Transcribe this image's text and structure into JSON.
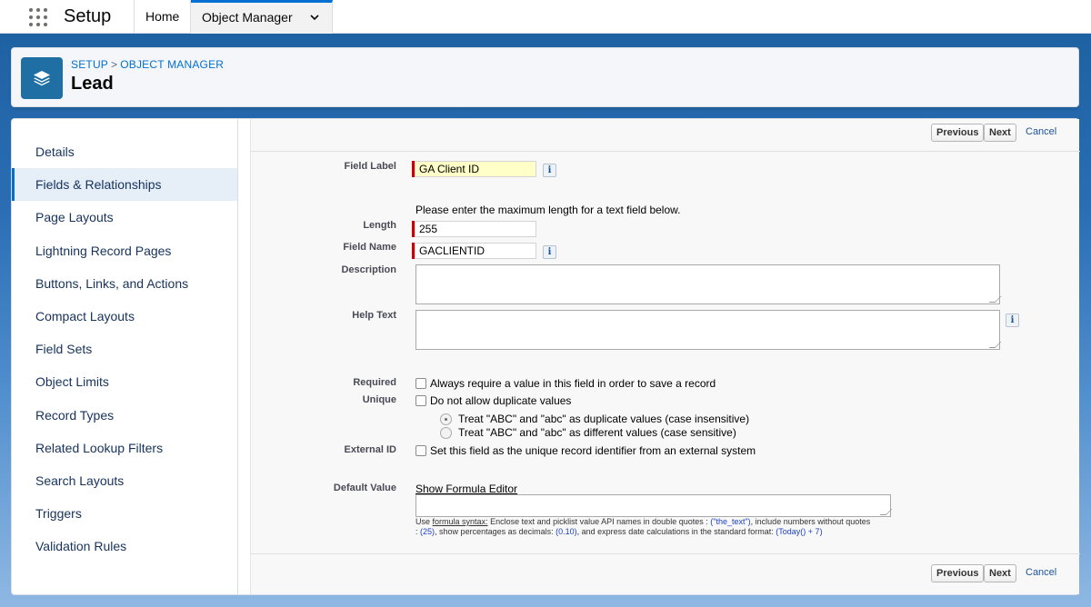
{
  "app": {
    "title": "Setup"
  },
  "nav": {
    "home": "Home",
    "object_manager": "Object Manager"
  },
  "header": {
    "breadcrumb_setup": "SETUP",
    "breadcrumb_sep": ">",
    "breadcrumb_om": "OBJECT MANAGER",
    "title": "Lead"
  },
  "sidebar": {
    "items": [
      {
        "label": "Details"
      },
      {
        "label": "Fields & Relationships"
      },
      {
        "label": "Page Layouts"
      },
      {
        "label": "Lightning Record Pages"
      },
      {
        "label": "Buttons, Links, and Actions"
      },
      {
        "label": "Compact Layouts"
      },
      {
        "label": "Field Sets"
      },
      {
        "label": "Object Limits"
      },
      {
        "label": "Record Types"
      },
      {
        "label": "Related Lookup Filters"
      },
      {
        "label": "Search Layouts"
      },
      {
        "label": "Triggers"
      },
      {
        "label": "Validation Rules"
      }
    ],
    "active_index": 1
  },
  "buttons": {
    "previous": "Previous",
    "next": "Next",
    "cancel": "Cancel"
  },
  "form": {
    "field_label": {
      "label": "Field Label",
      "value": "GA Client ID"
    },
    "length_note": "Please enter the maximum length for a text field below.",
    "length": {
      "label": "Length",
      "value": "255"
    },
    "field_name": {
      "label": "Field Name",
      "value": "GACLIENTID"
    },
    "description": {
      "label": "Description",
      "value": ""
    },
    "help_text": {
      "label": "Help Text",
      "value": ""
    },
    "required": {
      "label": "Required",
      "checkbox": "Always require a value in this field in order to save a record",
      "checked": false
    },
    "unique": {
      "label": "Unique",
      "checkbox": "Do not allow duplicate values",
      "checked": false,
      "option_insensitive": "Treat \"ABC\" and \"abc\" as duplicate values (case insensitive)",
      "option_sensitive": "Treat \"ABC\" and \"abc\" as different values (case sensitive)",
      "selected": "insensitive"
    },
    "external_id": {
      "label": "External ID",
      "checkbox": "Set this field as the unique record identifier from an external system",
      "checked": false
    },
    "default_value": {
      "label": "Default Value",
      "link": "Show Formula Editor",
      "help_use": "Use",
      "help_syntax": "formula syntax:",
      "help_1": "Enclose text and picklist value API names in double quotes :",
      "code_text": "(\"the_text\")",
      "help_2": ", include numbers without quotes",
      "help_colon": ":",
      "code_num": "(25)",
      "help_3": ", show percentages as decimals:",
      "code_pct": "(0.10)",
      "help_4": ", and express date calculations in the standard format:",
      "code_date": "(Today() + 7)"
    }
  },
  "colors": {
    "brand_blue": "#0070d2",
    "required_red": "#cc0000",
    "object_icon": "#1f6fa5"
  }
}
